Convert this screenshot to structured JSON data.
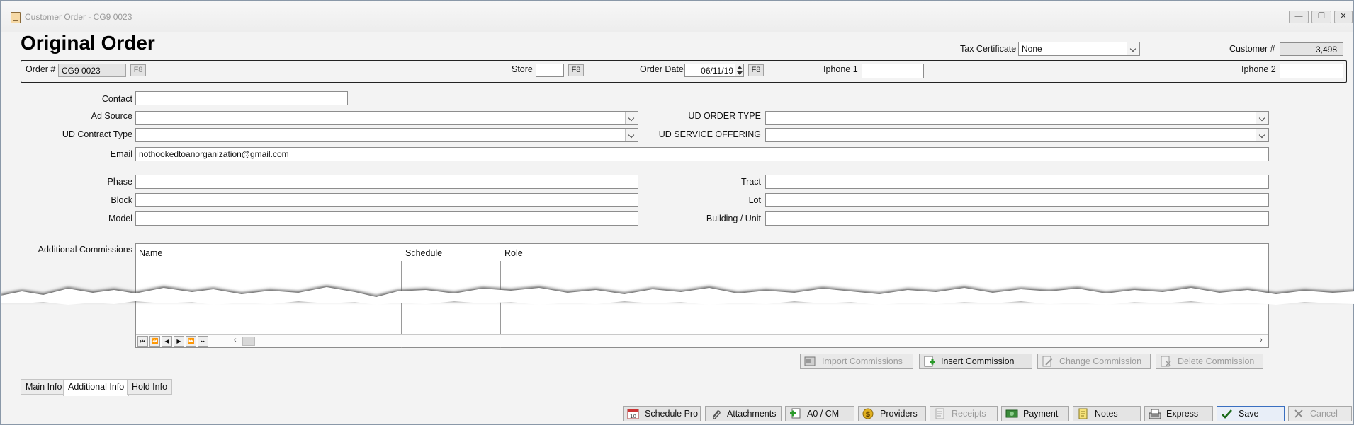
{
  "window": {
    "title": "Customer Order - CG9 0023",
    "minimize": "—",
    "restore": "❐",
    "close": "✕"
  },
  "page_title": "Original Order",
  "tax_certificate": {
    "label": "Tax Certificate",
    "value": "None"
  },
  "customer": {
    "label": "Customer #",
    "value": "3,498"
  },
  "header": {
    "order_label": "Order #",
    "order_value": "CG9 0023",
    "f8": "F8",
    "store_label": "Store",
    "store_value": "",
    "order_date_label": "Order Date",
    "order_date_value": "06/11/19",
    "phone1_label": "Iphone 1",
    "phone1_value": "",
    "phone2_label": "Iphone 2",
    "phone2_value": ""
  },
  "form": {
    "contact_label": "Contact",
    "contact_value": "",
    "ad_source_label": "Ad Source",
    "ad_source_value": "",
    "ud_contract_type_label": "UD Contract Type",
    "ud_contract_type_value": "",
    "ud_order_type_label": "UD ORDER TYPE",
    "ud_order_type_value": "",
    "ud_service_offering_label": "UD SERVICE OFFERING",
    "ud_service_offering_value": "",
    "email_label": "Email",
    "email_value": "nothookedtoanorganization@gmail.com"
  },
  "location": {
    "phase_label": "Phase",
    "block_label": "Block",
    "model_label": "Model",
    "tract_label": "Tract",
    "lot_label": "Lot",
    "building_label": "Building / Unit"
  },
  "commissions": {
    "label": "Additional Commissions",
    "columns": [
      "Name",
      "Schedule",
      "Role"
    ],
    "nav": [
      "⏮",
      "⏪",
      "◀",
      "▶",
      "⏩",
      "⏭"
    ]
  },
  "commission_buttons": {
    "import": "Import Commissions",
    "insert": "Insert Commission",
    "change": "Change Commission",
    "delete": "Delete Commission"
  },
  "tabs": [
    "Main Info",
    "Additional Info",
    "Hold Info"
  ],
  "footer_buttons": {
    "schedule_pro": "Schedule Pro",
    "attachments": "Attachments",
    "ao_cm": "A0 / CM",
    "providers": "Providers",
    "receipts": "Receipts",
    "payment": "Payment",
    "notes": "Notes",
    "express": "Express",
    "save": "Save",
    "cancel": "Cancel"
  }
}
